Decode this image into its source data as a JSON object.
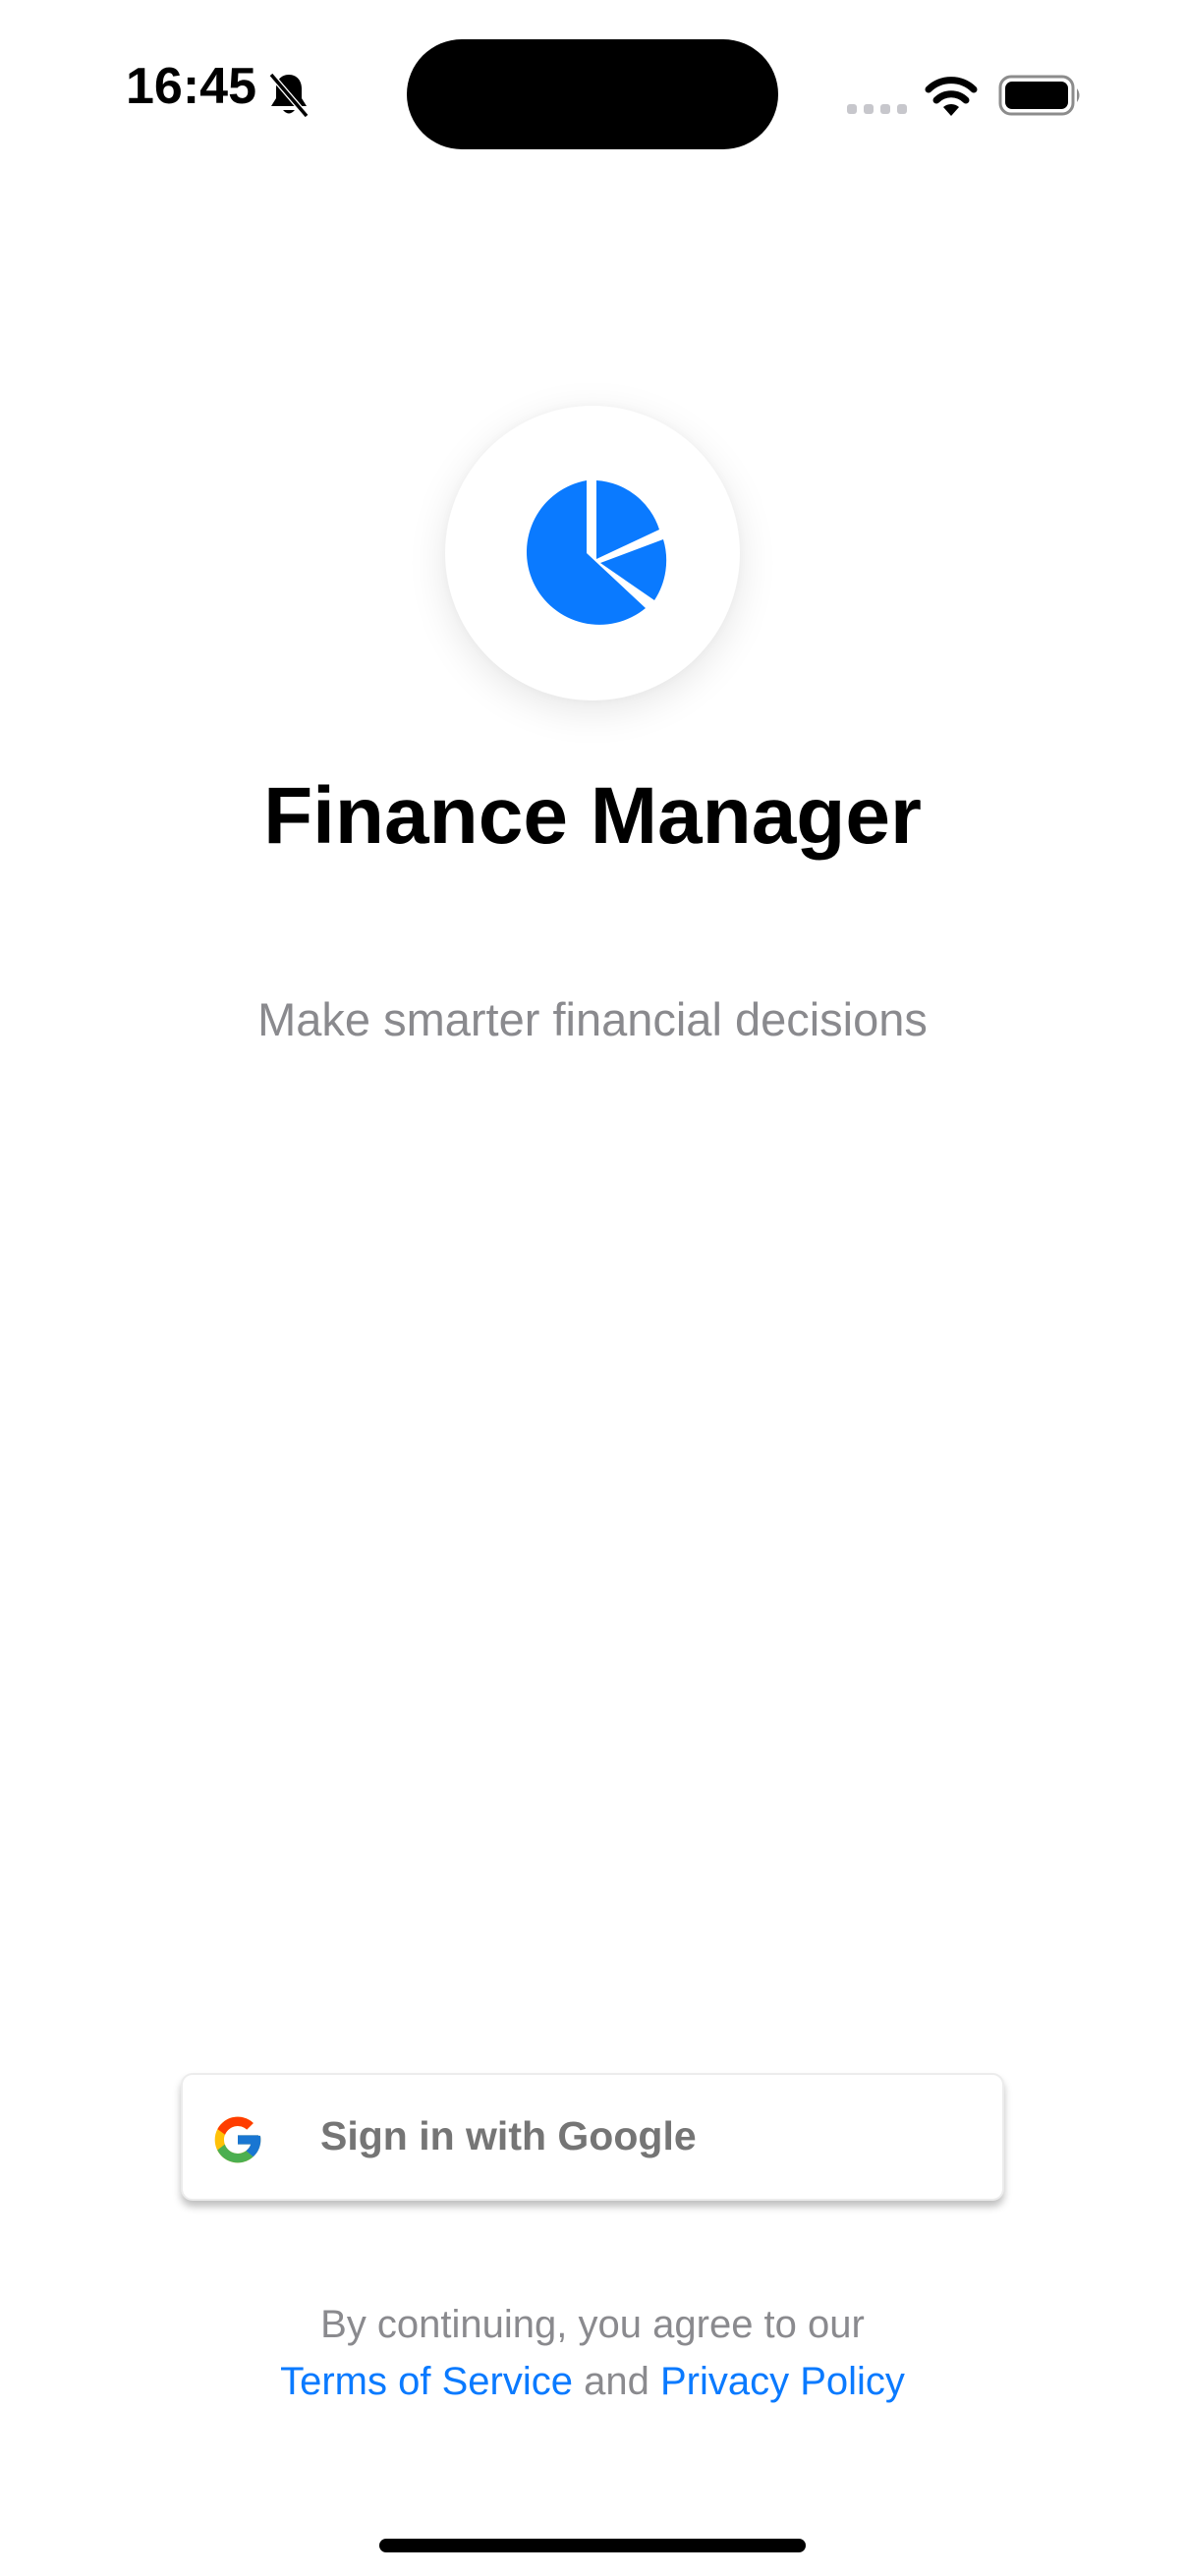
{
  "status_bar": {
    "time": "16:45",
    "icons": [
      "bell-slash-icon",
      "signal-icon",
      "wifi-icon",
      "battery-icon"
    ]
  },
  "app": {
    "logo_icon": "pie-chart-icon",
    "title": "Finance Manager",
    "tagline": "Make smarter financial decisions"
  },
  "sign_in": {
    "google_label": "Sign in with Google",
    "icon": "google-icon"
  },
  "legal": {
    "prefix": "By continuing, you agree to our",
    "terms_label": "Terms of Service",
    "and_label": "and",
    "privacy_label": "Privacy Policy"
  },
  "colors": {
    "accent": "#0A7AFF",
    "secondary_text": "#8A8A8E",
    "button_text": "#757575"
  }
}
